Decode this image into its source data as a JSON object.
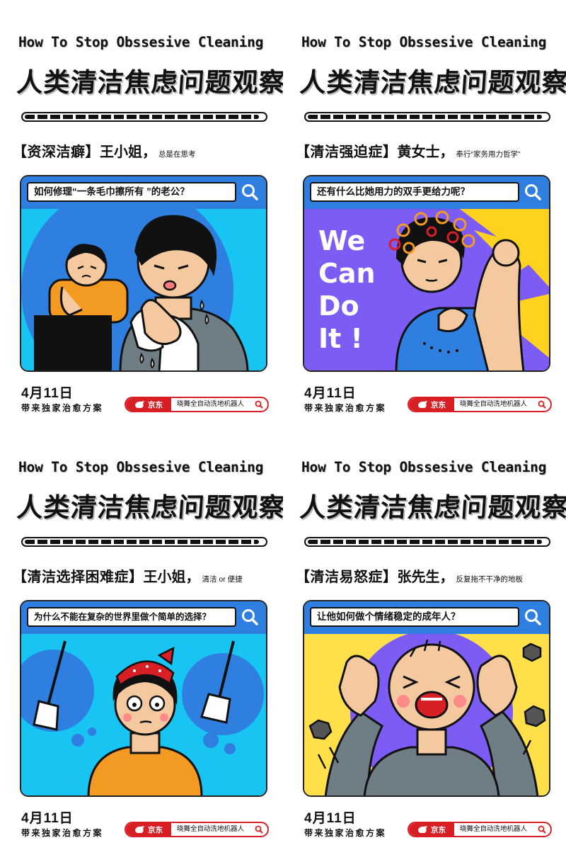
{
  "panels": [
    {
      "title_en": "How To Stop Obssesive Cleaning",
      "title_cn": "人类清洁焦虑问题观察",
      "tag": "【资深洁癖】",
      "person": "王小姐，",
      "note": "总是在思考",
      "search_text": "如何修理“一条毛巾擦所有 ”的老公？",
      "date": "4月11日",
      "tagline": "带来独家治愈方案",
      "brand": "京东",
      "product": "晓舞全自动洗地机器人",
      "colors": {
        "bg": "#17c4f2",
        "accent": "#f29a21"
      }
    },
    {
      "title_en": "How To Stop Obssesive Cleaning",
      "title_cn": "人类清洁焦虑问题观察",
      "tag": "【清洁强迫症】",
      "person": "黄女士，",
      "note": "奉行“家务用力哲学”",
      "search_text": "还有什么比她用力的双手更给力呢？",
      "poster_lines": [
        "We",
        "Can",
        "Do",
        "It !"
      ],
      "date": "4月11日",
      "tagline": "带来独家治愈方案",
      "brand": "京东",
      "product": "晓舞全自动洗地机器人",
      "colors": {
        "bg": "#7d5cf5",
        "accent": "#ffd21f"
      }
    },
    {
      "title_en": "How To Stop Obssesive Cleaning",
      "title_cn": "人类清洁焦虑问题观察",
      "tag": "【清洁选择困难症】",
      "person": "王小姐，",
      "note": "清洁 or 便捷",
      "search_text": "为什么不能在复杂的世界里做个简单的选择？",
      "date": "4月11日",
      "tagline": "带来独家治愈方案",
      "brand": "京东",
      "product": "晓舞全自动洗地机器人",
      "colors": {
        "bg": "#17c4f2",
        "accent": "#f29a21"
      }
    },
    {
      "title_en": "How To Stop Obssesive Cleaning",
      "title_cn": "人类清洁焦虑问题观察",
      "tag": "【清洁易怒症】",
      "person": "张先生，",
      "note": "反复拖不干净的地板",
      "search_text": "让他如何做个情绪稳定的成年人？",
      "date": "4月11日",
      "tagline": "带来独家治愈方案",
      "brand": "京东",
      "product": "晓舞全自动洗地机器人",
      "colors": {
        "bg": "#ffe04a",
        "accent": "#7d5cf5"
      }
    }
  ],
  "icons": {
    "search": "search-icon",
    "brand_logo": "jd-dog-icon"
  },
  "progress_fraction": 0.98,
  "brand_color": "#d91f26",
  "search_bar_color": "#2f7fe0"
}
